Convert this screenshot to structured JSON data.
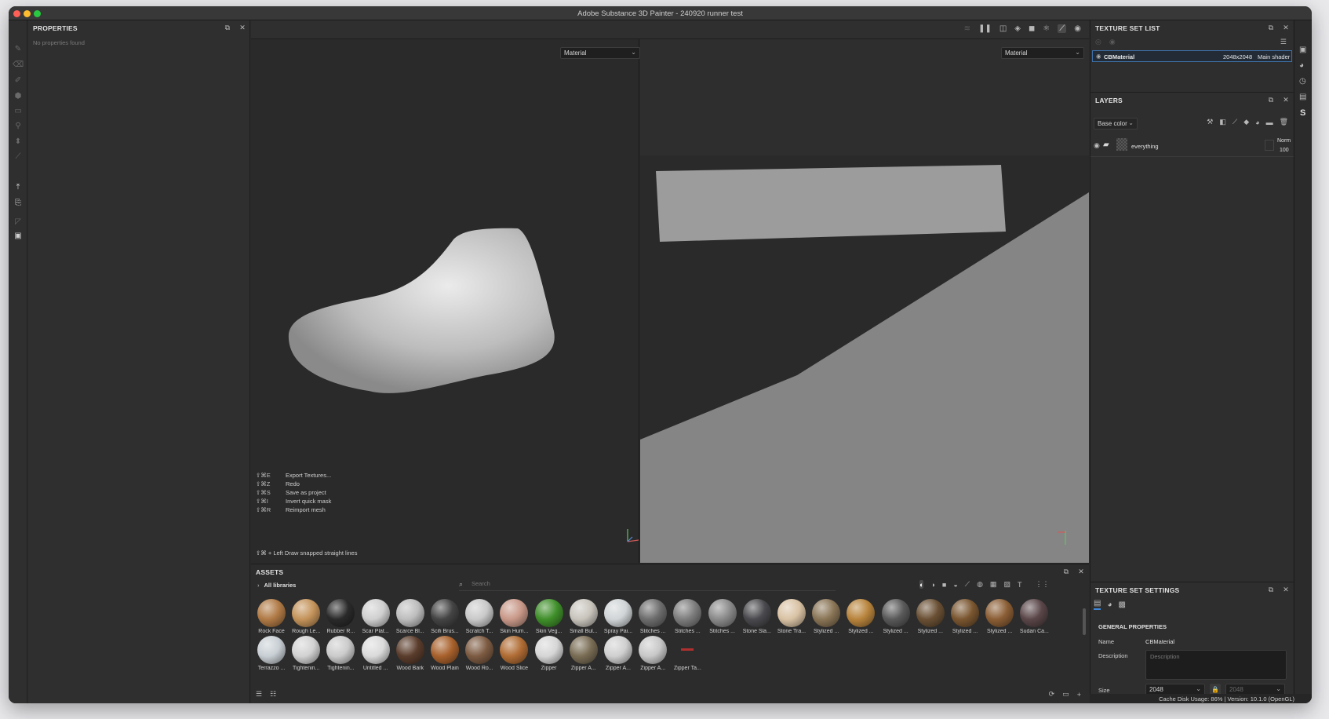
{
  "window": {
    "title": "Adobe Substance 3D Painter - 240920 runner test"
  },
  "properties": {
    "title": "PROPERTIES",
    "empty_text": "No properties found"
  },
  "viewport": {
    "left_mode": "Material",
    "right_mode": "Material",
    "shortcuts": [
      {
        "keys": "⇧⌘E",
        "action": "Export Textures..."
      },
      {
        "keys": "⇧⌘Z",
        "action": "Redo"
      },
      {
        "keys": "⇧⌘S",
        "action": "Save as project"
      },
      {
        "keys": "⇧⌘I",
        "action": "Invert quick mask"
      },
      {
        "keys": "⇧⌘R",
        "action": "Reimport mesh"
      }
    ],
    "hint": "⇧⌘ + Left  Draw snapped straight lines"
  },
  "assets": {
    "title": "ASSETS",
    "library": "All libraries",
    "search_placeholder": "Search",
    "row1": [
      {
        "label": "Rock Face",
        "color": "#b07a45"
      },
      {
        "label": "Rough Le...",
        "color": "#c4935a"
      },
      {
        "label": "Rubber R...",
        "color": "#2a2a2a"
      },
      {
        "label": "Scar Plat...",
        "color": "#cfcfcf"
      },
      {
        "label": "Scarce Bl...",
        "color": "#bdbdbd"
      },
      {
        "label": "Scifi Brus...",
        "color": "#444444"
      },
      {
        "label": "Scratch T...",
        "color": "#c9c9c9"
      },
      {
        "label": "Skin Hum...",
        "color": "#c89888"
      },
      {
        "label": "Skin Veg...",
        "color": "#3f8f2a"
      },
      {
        "label": "Small Bul...",
        "color": "#c8c4bc"
      },
      {
        "label": "Spray Pai...",
        "color": "#d0d4d6"
      },
      {
        "label": "Stitches ...",
        "color": "#6d6d6d"
      },
      {
        "label": "Stitches ...",
        "color": "#7d7d7d"
      },
      {
        "label": "Stitches ...",
        "color": "#8a8a8a"
      },
      {
        "label": "Stone Sla...",
        "color": "#4a4a4e"
      },
      {
        "label": "Stone Tra...",
        "color": "#d9c2a4"
      },
      {
        "label": "Stylized ...",
        "color": "#8a7556"
      },
      {
        "label": "Stylized ...",
        "color": "#b8843c"
      },
      {
        "label": "Stylized ...",
        "color": "#595959"
      },
      {
        "label": "Stylized ...",
        "color": "#6a5034"
      },
      {
        "label": "Stylized ...",
        "color": "#7a5630"
      },
      {
        "label": "Stylized ...",
        "color": "#8b5e35"
      },
      {
        "label": "Sudan Ca...",
        "color": "#5a4649"
      }
    ],
    "row2": [
      {
        "label": "Terrazzo ...",
        "color": "#c8cfd4"
      },
      {
        "label": "Tightenin...",
        "color": "#d2d2d2"
      },
      {
        "label": "Tightenin...",
        "color": "#cbcbcb"
      },
      {
        "label": "Untitled ...",
        "color": "#dadada"
      },
      {
        "label": "Wood Bark",
        "color": "#5b3d2c"
      },
      {
        "label": "Wood Plain",
        "color": "#a8612c"
      },
      {
        "label": "Wood Ro...",
        "color": "#7d5b42"
      },
      {
        "label": "Wood Slice",
        "color": "#b06c34"
      },
      {
        "label": "Zipper",
        "color": "#d6d6d6"
      },
      {
        "label": "Zipper A...",
        "color": "#7a6d55"
      },
      {
        "label": "Zipper A...",
        "color": "#cfcfcf"
      },
      {
        "label": "Zipper A...",
        "color": "#c8c8c8"
      },
      {
        "label": "Zipper Ta...",
        "color": ""
      }
    ]
  },
  "texture_set_list": {
    "title": "TEXTURE SET LIST",
    "item": {
      "name": "CBMaterial",
      "resolution": "2048x2048",
      "shader": "Main shader"
    }
  },
  "layers": {
    "title": "LAYERS",
    "channel": "Base color",
    "layer": {
      "name": "everything",
      "blend": "Norm",
      "opacity": "100"
    }
  },
  "texture_set_settings": {
    "title": "TEXTURE SET SETTINGS",
    "section": "GENERAL PROPERTIES",
    "name_label": "Name",
    "name_value": "CBMaterial",
    "description_label": "Description",
    "description_placeholder": "Description",
    "size_label": "Size",
    "size_value": "2048",
    "size_linked": "2048"
  },
  "status": {
    "text": "Cache Disk Usage:     86% | Version: 10.1.0 (OpenGL)"
  }
}
